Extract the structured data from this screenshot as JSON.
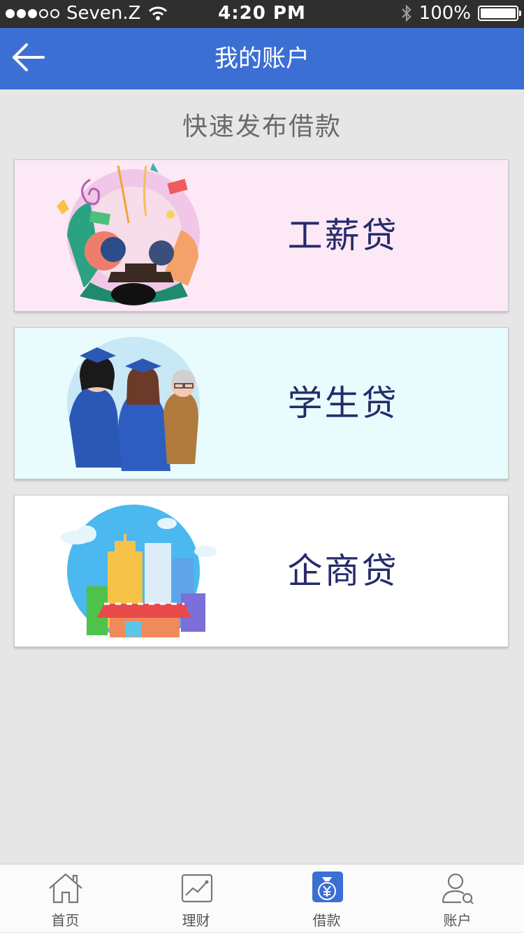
{
  "status_bar": {
    "carrier": "Seven.Z",
    "time": "4:20 PM",
    "battery": "100%"
  },
  "nav": {
    "title": "我的账户"
  },
  "section_title": "快速发布借款",
  "loans": [
    {
      "label": "工薪贷",
      "bg": "#fde8f6"
    },
    {
      "label": "学生贷",
      "bg": "#e8fbfd"
    },
    {
      "label": "企商贷",
      "bg": "#ffffff"
    }
  ],
  "tabs": [
    {
      "label": "首页",
      "icon": "home-icon"
    },
    {
      "label": "理财",
      "icon": "chart-icon"
    },
    {
      "label": "借款",
      "icon": "money-bag-icon",
      "active": true
    },
    {
      "label": "账户",
      "icon": "user-icon"
    }
  ],
  "colors": {
    "primary": "#3b6fd4",
    "background": "#e7e6e7",
    "loan_label": "#252b6a"
  }
}
